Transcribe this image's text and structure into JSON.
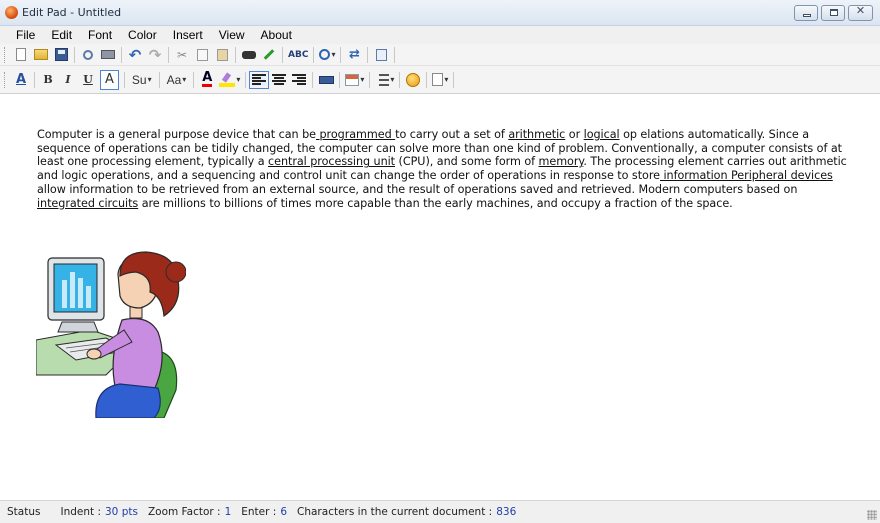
{
  "window": {
    "title": "Edit Pad - Untitled",
    "controls": {
      "minimize": "minimize",
      "maximize": "maximize",
      "close": "✕"
    }
  },
  "menu": [
    "File",
    "Edit",
    "Font",
    "Color",
    "Insert",
    "View",
    "About"
  ],
  "toolbar1": {
    "icons": [
      "new-document-icon",
      "open-folder-icon",
      "save-icon",
      "print-preview-icon",
      "print-icon",
      "undo-icon",
      "redo-icon",
      "cut-icon",
      "copy-icon",
      "paste-icon",
      "find-icon",
      "draw-icon",
      "spell-check-icon",
      "zoom-icon",
      "refresh-icon",
      "page-setup-icon"
    ],
    "spell_label": "ABC"
  },
  "toolbar2": {
    "bold": "B",
    "italic": "I",
    "underline": "U",
    "font_a": "A",
    "superscript": "Su",
    "font_size": "Aa",
    "font_color": "A",
    "font_color_hex": "#e00000",
    "highlight_color_hex": "#ffe600",
    "alignment_selected": "left"
  },
  "document": {
    "segments": [
      {
        "t": "Computer is a general purpose device that can be",
        "u": false
      },
      {
        "t": " programmed ",
        "u": true
      },
      {
        "t": "to carry out a set of ",
        "u": false
      },
      {
        "t": "arithmetic",
        "u": true
      },
      {
        "t": " or ",
        "u": false
      },
      {
        "t": "logical",
        "u": true
      },
      {
        "t": " op elations automatically. Since a sequence of operations can be tidily changed, the computer can solve more than one kind of problem. Conventionally, a computer consists of at least one processing element, typically a ",
        "u": false
      },
      {
        "t": "central processing unit",
        "u": true
      },
      {
        "t": " (CPU), and some form of ",
        "u": false
      },
      {
        "t": "memory",
        "u": true
      },
      {
        "t": ". The processing element carries out arithmetic and logic operations, and a sequencing and control unit can change the order of operations in response to store",
        "u": false
      },
      {
        "t": " information Peripheral devices",
        "u": true
      },
      {
        "t": " allow information to be retrieved from an external source, and the result of operations saved and retrieved. Modern computers based on ",
        "u": false
      },
      {
        "t": "integrated circuits",
        "u": true
      },
      {
        "t": " are millions to billions of times more capable than the early machines, and occupy a fraction of the space.",
        "u": false
      }
    ]
  },
  "status": {
    "label": "Status",
    "indent_key": "Indent :",
    "indent_val": "30 pts",
    "zoom_key": "Zoom Factor :",
    "zoom_val": "1",
    "enter_key": "Enter :",
    "enter_val": "6",
    "chars_key": "Characters in the current document :",
    "chars_val": "836"
  }
}
